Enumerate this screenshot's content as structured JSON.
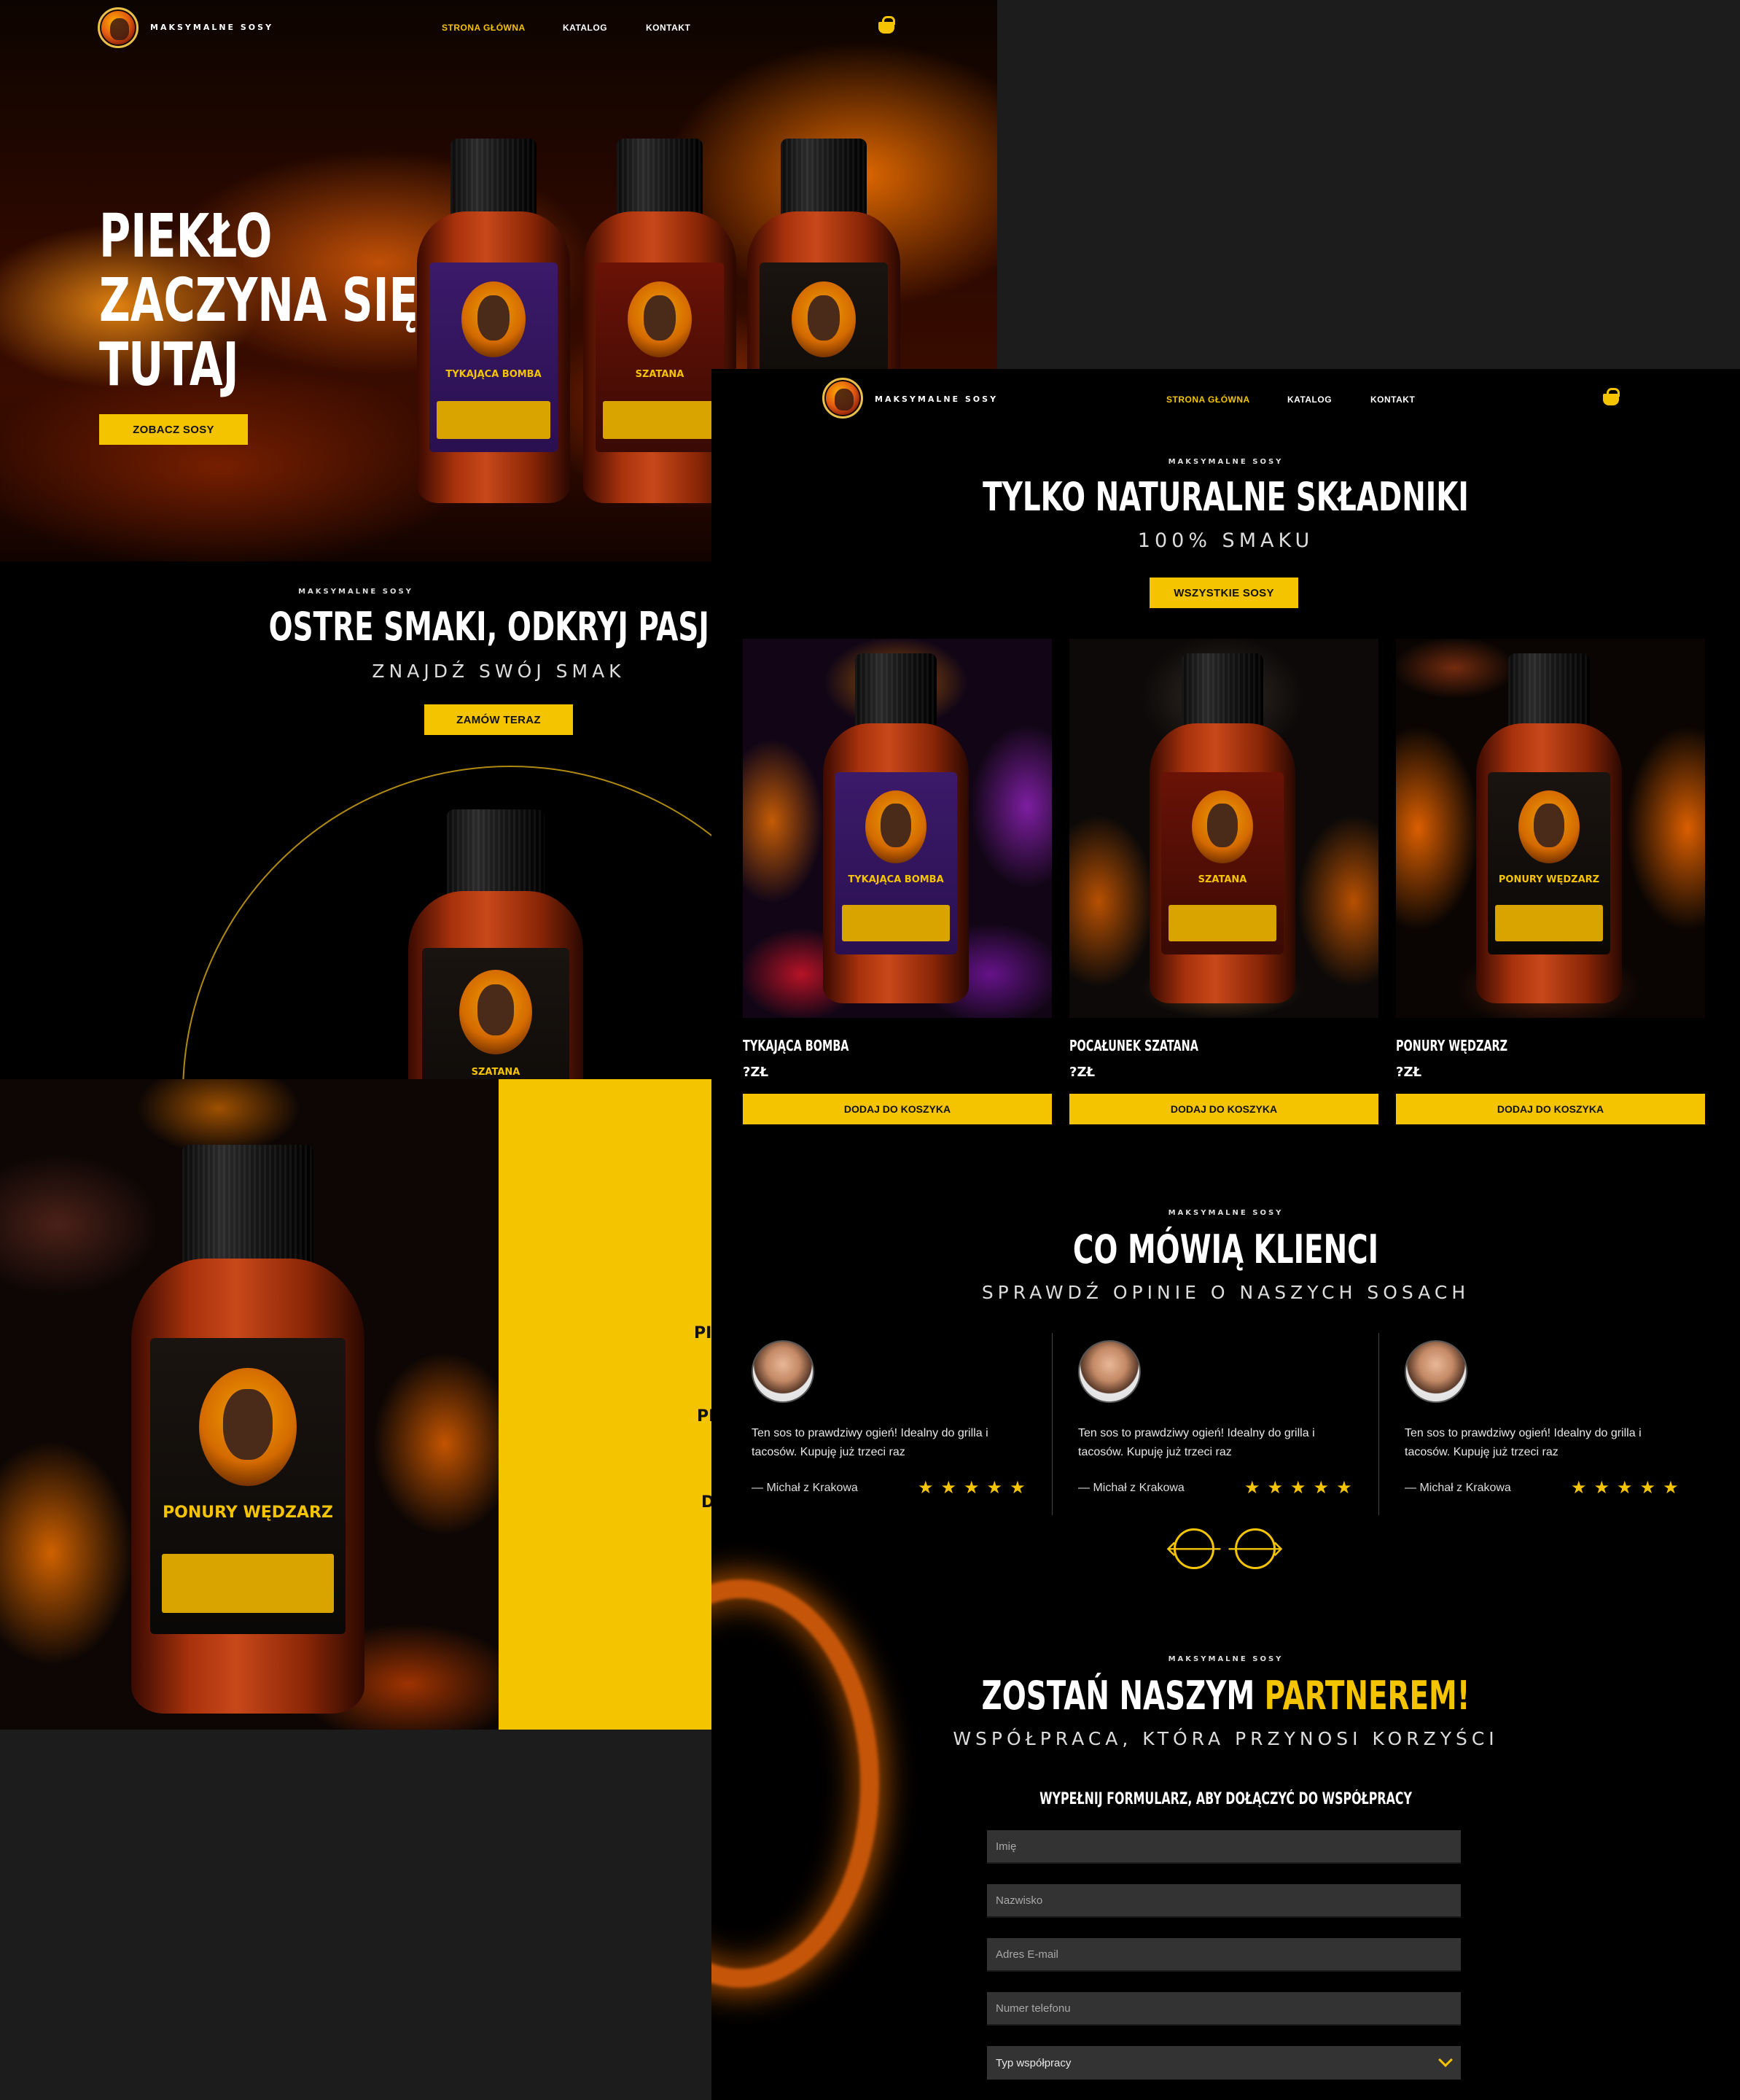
{
  "brand": "MAKSYMALNE SOSY",
  "nav": {
    "home": "STRONA GŁÓWNA",
    "catalog": "KATALOG",
    "contact": "KONTAKT"
  },
  "colors": {
    "accent": "#f5c400",
    "background": "#000000",
    "canvas": "#1c1c1c"
  },
  "left": {
    "hero": {
      "line1": "PIEKŁO",
      "line2": "ZACZYNA SIĘ",
      "line3": "TUTAJ",
      "button": "ZOBACZ SOSY"
    },
    "section": {
      "eyebrow": "MAKSYMALNE SOSY",
      "title": "OSTRE SMAKI, ODKRYJ PASJĘ",
      "subtitle": "ZNAJDŹ SWÓJ SMAK",
      "button": "ZAMÓW TERAZ"
    },
    "partial_words": [
      "PIE",
      "PR",
      "D"
    ]
  },
  "right": {
    "intro": {
      "eyebrow": "MAKSYMALNE SOSY",
      "title": "TYLKO NATURALNE SKŁADNIKI",
      "subtitle": "100% SMAKU",
      "button": "WSZYSTKIE SOSY"
    },
    "products": [
      {
        "name": "TYKAJĄCA BOMBA",
        "price": "?ZŁ",
        "button": "DODAJ DO KOSZYKA",
        "label_text": "TYKAJĄCA BOMBA"
      },
      {
        "name": "POCAŁUNEK SZATANA",
        "price": "?ZŁ",
        "button": "DODAJ DO KOSZYKA",
        "label_text": "SZATANA"
      },
      {
        "name": "PONURY WĘDZARZ",
        "price": "?ZŁ",
        "button": "DODAJ DO KOSZYKA",
        "label_text": "PONURY WĘDZARZ"
      }
    ],
    "reviews_section": {
      "eyebrow": "MAKSYMALNE SOSY",
      "title": "CO MÓWIĄ KLIENCI",
      "subtitle": "SPRAWDŹ OPINIE O NASZYCH SOSACH"
    },
    "reviews": [
      {
        "text": "Ten sos to prawdziwy ogień! Idealny do grilla i tacosów. Kupuję już trzeci raz",
        "author": "— Michał z Krakowa",
        "rating": 5,
        "stars": "★★★★★"
      },
      {
        "text": "Ten sos to prawdziwy ogień! Idealny do grilla i tacosów. Kupuję już trzeci raz",
        "author": "— Michał z Krakowa",
        "rating": 5,
        "stars": "★★★★★"
      },
      {
        "text": "Ten sos to prawdziwy ogień! Idealny do grilla i tacosów. Kupuję już trzeci raz",
        "author": "— Michał z Krakowa",
        "rating": 5,
        "stars": "★★★★★"
      }
    ],
    "arrows": {
      "prev": "🡐",
      "next": "🡒"
    },
    "partner": {
      "eyebrow": "MAKSYMALNE SOSY",
      "title_main": "ZOSTAŃ NASZYM ",
      "title_accent": "PARTNEREM!",
      "subtitle": "WSPÓŁPRACA, KTÓRA PRZYNOSI KORZYŚCI",
      "form_heading": "WYPEŁNIJ FORMULARZ, ABY DOŁĄCZYĆ DO WSPÓŁPRACY",
      "fields": {
        "first_name": "Imię",
        "last_name": "Nazwisko",
        "email": "Adres E-mail",
        "phone": "Numer telefonu"
      },
      "select_value": "Typ współpracy"
    }
  },
  "icons": [
    "cart-icon",
    "logo-icon",
    "arrow-left-icon",
    "arrow-right-icon",
    "chevron-down-icon",
    "star-icon"
  ]
}
